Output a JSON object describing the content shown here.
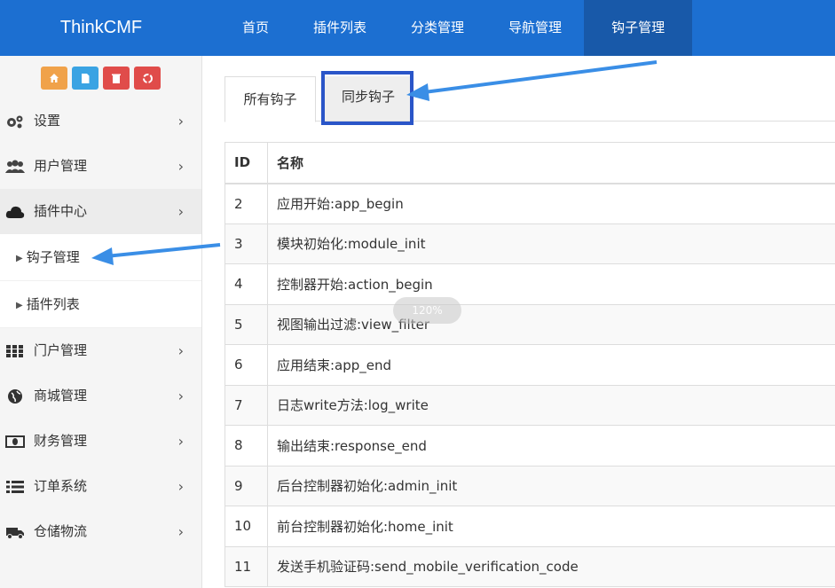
{
  "brand": "ThinkCMF",
  "nav": [
    "首页",
    "插件列表",
    "分类管理",
    "导航管理",
    "钩子管理"
  ],
  "sidebar": {
    "items": [
      {
        "label": "设置",
        "icon": "gear-icon"
      },
      {
        "label": "用户管理",
        "icon": "users-icon"
      },
      {
        "label": "插件中心",
        "icon": "cloud-icon"
      },
      {
        "label": "门户管理",
        "icon": "grid-icon"
      },
      {
        "label": "商城管理",
        "icon": "globe-icon"
      },
      {
        "label": "财务管理",
        "icon": "money-icon"
      },
      {
        "label": "订单系统",
        "icon": "list-icon"
      },
      {
        "label": "仓储物流",
        "icon": "truck-icon"
      }
    ],
    "subitems": [
      "钩子管理",
      "插件列表"
    ]
  },
  "tabs": [
    "所有钩子",
    "同步钩子"
  ],
  "table": {
    "headers": [
      "ID",
      "名称"
    ],
    "rows": [
      [
        "2",
        "应用开始:app_begin"
      ],
      [
        "3",
        "模块初始化:module_init"
      ],
      [
        "4",
        "控制器开始:action_begin"
      ],
      [
        "5",
        "视图输出过滤:view_filter"
      ],
      [
        "6",
        "应用结束:app_end"
      ],
      [
        "7",
        "日志write方法:log_write"
      ],
      [
        "8",
        "输出结束:response_end"
      ],
      [
        "9",
        "后台控制器初始化:admin_init"
      ],
      [
        "10",
        "前台控制器初始化:home_init"
      ],
      [
        "11",
        "发送手机验证码:send_mobile_verification_code"
      ]
    ]
  },
  "zoom": "120%",
  "colors": {
    "topbar": "#1c6fd1",
    "nav_active": "#1859a9",
    "highlight": "#2a55c8",
    "arrow": "#3a8ee6"
  }
}
